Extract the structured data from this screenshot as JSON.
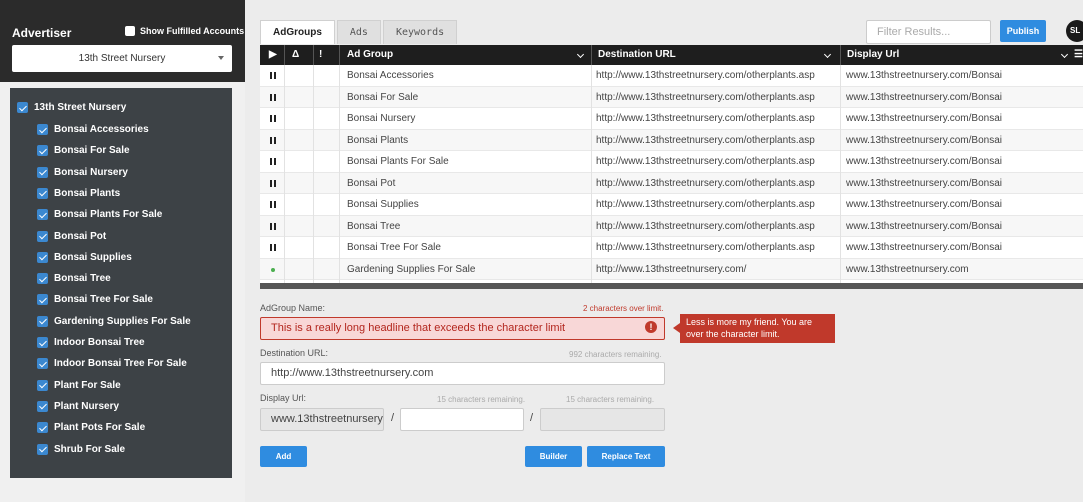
{
  "sidebar": {
    "title": "Advertiser",
    "show_fulfilled_label": "Show Fulfilled Accounts",
    "account_selected": "13th Street Nursery",
    "tree": [
      {
        "label": "13th Street Nursery",
        "checked": true,
        "level": 0
      },
      {
        "label": "Bonsai Accessories",
        "checked": true,
        "level": 1
      },
      {
        "label": "Bonsai For Sale",
        "checked": true,
        "level": 1
      },
      {
        "label": "Bonsai Nursery",
        "checked": true,
        "level": 1
      },
      {
        "label": "Bonsai Plants",
        "checked": true,
        "level": 1
      },
      {
        "label": "Bonsai Plants For Sale",
        "checked": true,
        "level": 1
      },
      {
        "label": "Bonsai Pot",
        "checked": true,
        "level": 1
      },
      {
        "label": "Bonsai Supplies",
        "checked": true,
        "level": 1
      },
      {
        "label": "Bonsai Tree",
        "checked": true,
        "level": 1
      },
      {
        "label": "Bonsai Tree For Sale",
        "checked": true,
        "level": 1
      },
      {
        "label": "Gardening Supplies For Sale",
        "checked": true,
        "level": 1
      },
      {
        "label": "Indoor Bonsai Tree",
        "checked": true,
        "level": 1
      },
      {
        "label": "Indoor Bonsai Tree For Sale",
        "checked": true,
        "level": 1
      },
      {
        "label": "Plant For Sale",
        "checked": true,
        "level": 1
      },
      {
        "label": "Plant Nursery",
        "checked": true,
        "level": 1
      },
      {
        "label": "Plant Pots For Sale",
        "checked": true,
        "level": 1
      },
      {
        "label": "Shrub For Sale",
        "checked": true,
        "level": 1
      }
    ]
  },
  "tabs": [
    {
      "label": "AdGroups",
      "active": true
    },
    {
      "label": "Ads",
      "active": false
    },
    {
      "label": "Keywords",
      "active": false
    }
  ],
  "filter": {
    "placeholder": "Filter Results..."
  },
  "publish_label": "Publish",
  "avatar_initials": "SL",
  "grid": {
    "headers": {
      "play": "▶",
      "delta": "Δ",
      "info": "!",
      "ad_group": "Ad Group",
      "destination": "Destination URL",
      "display": "Display Url"
    },
    "rows": [
      {
        "status": "paused",
        "ad_group": "Bonsai Accessories",
        "destination": "http://www.13thstreetnursery.com/otherplants.asp",
        "display": "www.13thstreetnursery.com/Bonsai"
      },
      {
        "status": "paused",
        "ad_group": "Bonsai For Sale",
        "destination": "http://www.13thstreetnursery.com/otherplants.asp",
        "display": "www.13thstreetnursery.com/Bonsai"
      },
      {
        "status": "paused",
        "ad_group": "Bonsai Nursery",
        "destination": "http://www.13thstreetnursery.com/otherplants.asp",
        "display": "www.13thstreetnursery.com/Bonsai"
      },
      {
        "status": "paused",
        "ad_group": "Bonsai Plants",
        "destination": "http://www.13thstreetnursery.com/otherplants.asp",
        "display": "www.13thstreetnursery.com/Bonsai"
      },
      {
        "status": "paused",
        "ad_group": "Bonsai Plants For Sale",
        "destination": "http://www.13thstreetnursery.com/otherplants.asp",
        "display": "www.13thstreetnursery.com/Bonsai"
      },
      {
        "status": "paused",
        "ad_group": "Bonsai Pot",
        "destination": "http://www.13thstreetnursery.com/otherplants.asp",
        "display": "www.13thstreetnursery.com/Bonsai"
      },
      {
        "status": "paused",
        "ad_group": "Bonsai Supplies",
        "destination": "http://www.13thstreetnursery.com/otherplants.asp",
        "display": "www.13thstreetnursery.com/Bonsai"
      },
      {
        "status": "paused",
        "ad_group": "Bonsai Tree",
        "destination": "http://www.13thstreetnursery.com/otherplants.asp",
        "display": "www.13thstreetnursery.com/Bonsai"
      },
      {
        "status": "paused",
        "ad_group": "Bonsai Tree For Sale",
        "destination": "http://www.13thstreetnursery.com/otherplants.asp",
        "display": "www.13thstreetnursery.com/Bonsai"
      },
      {
        "status": "active",
        "ad_group": "Gardening Supplies For Sale",
        "destination": "http://www.13thstreetnursery.com/",
        "display": "www.13thstreetnursery.com"
      }
    ]
  },
  "form": {
    "adgroup_name_label": "AdGroup Name:",
    "adgroup_name_hint": "2 characters over limit.",
    "adgroup_name_value": "This is a really long headline that exceeds the character limit",
    "error_tooltip": "Less is more my friend. You are over the character limit.",
    "destination_label": "Destination URL:",
    "destination_hint": "992 characters remaining.",
    "destination_value": "http://www.13thstreetnursery.com",
    "display_label": "Display Url:",
    "display_hint_1": "15 characters remaining.",
    "display_hint_2": "15 characters remaining.",
    "display_value_1": "www.13thstreetnursery.",
    "display_value_2": "",
    "display_value_3": "",
    "slash": "/",
    "add_label": "Add",
    "builder_label": "Builder",
    "replace_label": "Replace Text"
  },
  "colors": {
    "accent": "#2f8ce0",
    "error": "#c0392b",
    "sidebar_dark": "#3d4246",
    "header_dark": "#1e1e1e"
  }
}
